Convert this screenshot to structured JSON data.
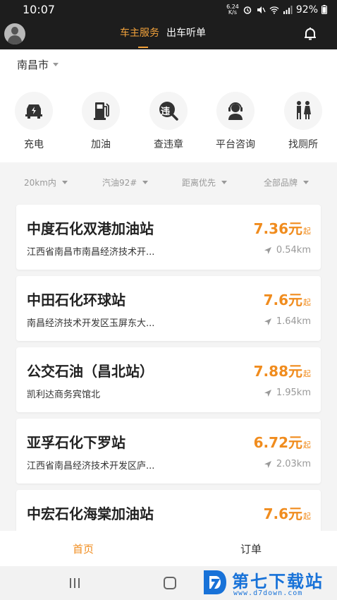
{
  "status_bar": {
    "time": "10:07",
    "net_speed_value": "6.24",
    "net_speed_unit": "K/s",
    "battery": "92%"
  },
  "header": {
    "tabs": [
      {
        "label": "车主服务",
        "active": true
      },
      {
        "label": "出车听单",
        "active": false
      }
    ],
    "accent_color": "#f2a23b"
  },
  "location": {
    "city": "南昌市"
  },
  "services": [
    {
      "label": "充电",
      "icon": "car-charging-icon"
    },
    {
      "label": "加油",
      "icon": "fuel-pump-icon"
    },
    {
      "label": "查违章",
      "icon": "violation-icon",
      "badge": "违"
    },
    {
      "label": "平台咨询",
      "icon": "customer-service-icon"
    },
    {
      "label": "找厕所",
      "icon": "restroom-icon"
    }
  ],
  "filters": [
    {
      "label": "20km内"
    },
    {
      "label": "汽油92#"
    },
    {
      "label": "距离优先"
    },
    {
      "label": "全部品牌"
    }
  ],
  "stations": [
    {
      "name": "中度石化双港加油站",
      "address": "江西省南昌市南昌经济技术开...",
      "price": "7.36",
      "unit": "元",
      "suffix": "起",
      "distance": "0.54km"
    },
    {
      "name": "中田石化环球站",
      "address": "南昌经济技术开发区玉屏东大...",
      "price": "7.6",
      "unit": "元",
      "suffix": "起",
      "distance": "1.64km"
    },
    {
      "name": "公交石油（昌北站）",
      "address": "凯利达商务宾馆北",
      "price": "7.88",
      "unit": "元",
      "suffix": "起",
      "distance": "1.95km"
    },
    {
      "name": "亚孚石化下罗站",
      "address": "江西省南昌经济技术开发区庐...",
      "price": "6.72",
      "unit": "元",
      "suffix": "起",
      "distance": "2.03km"
    },
    {
      "name": "中宏石化海棠加油站",
      "address": "",
      "price": "7.6",
      "unit": "元",
      "suffix": "起",
      "distance": ""
    }
  ],
  "tabbar": {
    "home": "首页",
    "orders": "订单",
    "active_color": "#f08c1e"
  },
  "watermark": {
    "text": "第七下载站",
    "url": "www.d7down.com"
  }
}
